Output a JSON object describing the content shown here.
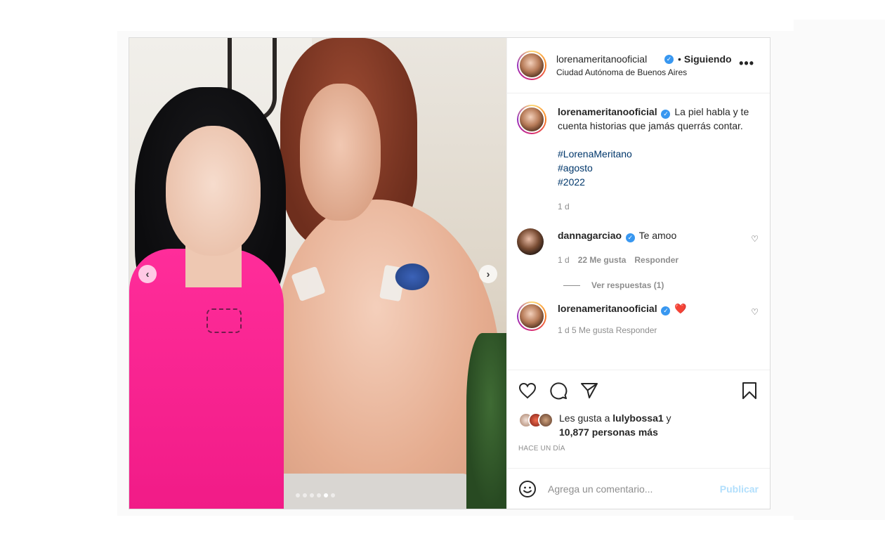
{
  "post": {
    "header": {
      "username": "lorenameritanooficial",
      "separator": "•",
      "following_label": "Siguiendo",
      "location": "Ciudad Autónoma de Buenos Aires",
      "more_icon": "•••"
    },
    "caption": {
      "username": "lorenameritanooficial",
      "text": "La piel habla y te cuenta historias que jamás querrás contar.",
      "hashtags": [
        "#LorenaMeritano",
        "#agosto",
        "#2022"
      ],
      "time": "1 d"
    },
    "comments": [
      {
        "username": "dannagarciao",
        "text": "Te amoo",
        "time": "1 d",
        "likes": "22 Me gusta",
        "reply_label": "Responder",
        "view_replies": "Ver respuestas (1)"
      },
      {
        "username": "lorenameritanooficial",
        "text": "❤️",
        "partial_meta": "1 d   5 Me gusta   Responder"
      }
    ],
    "likes": {
      "prefix": "Les gusta a",
      "user": "lulybossa1",
      "connector": "y",
      "count_text": "10,877 personas más"
    },
    "posted_ago": "HACE UN DÍA",
    "add_comment": {
      "placeholder": "Agrega un comentario...",
      "publish_label": "Publicar"
    },
    "media": {
      "prev_icon": "‹",
      "next_icon": "›",
      "carousel_count": 6,
      "carousel_active": 5
    },
    "colors": {
      "verified": "#3897f0",
      "link": "#00376b",
      "publish_disabled": "#b2dffc"
    }
  }
}
